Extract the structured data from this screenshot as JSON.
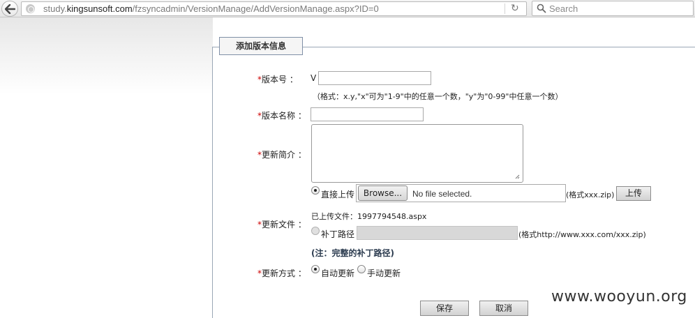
{
  "browser": {
    "url_prefix": "study.",
    "url_host": "kingsunsoft.com",
    "url_path": "/fzsyncadmin/VersionManage/AddVersionManage.aspx?ID=0",
    "search_placeholder": "Search"
  },
  "form": {
    "legend": "添加版本信息",
    "required_mark": "*",
    "version_no": {
      "label": "版本号 ：",
      "prefix": "V",
      "value": "",
      "hint": "（格式：x.y,\"x\"可为\"1-9\"中的任意一个数，\"y\"为\"0-99\"中任意一个数）"
    },
    "version_name": {
      "label": "版本名称 ：",
      "value": ""
    },
    "update_summary": {
      "label": "更新简介 ：",
      "value": ""
    },
    "update_file": {
      "label": "更新文件 ：",
      "direct_upload_label": "直接上传",
      "browse_label": "Browse...",
      "no_file_text": "No file selected.",
      "zip_format": "(格式xxx.zip)",
      "upload_button": "上传",
      "uploaded_text": "已上传文件：1997794548.aspx",
      "patch_path_label": "补丁路径",
      "patch_format": "(格式http://www.xxx.com/xxx.zip)",
      "note": "(注：完整的补丁路径)"
    },
    "update_mode": {
      "label": "更新方式 ：",
      "auto_label": "自动更新",
      "manual_label": "手动更新"
    },
    "save_button": "保存",
    "cancel_button": "取消"
  },
  "watermark": "www.wooyun.org"
}
